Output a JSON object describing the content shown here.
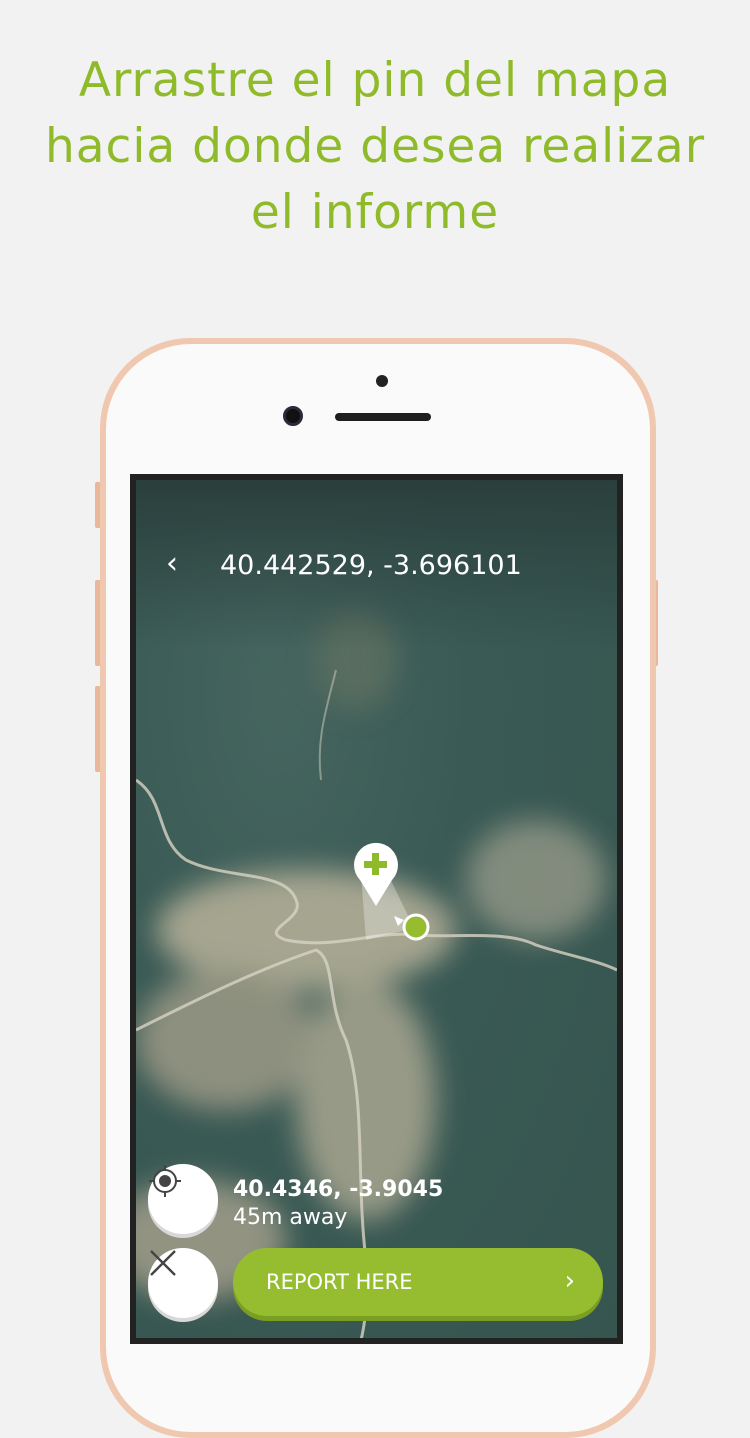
{
  "headline": {
    "line1": "Arrastre el pin del mapa",
    "line2": "hacia donde desea realizar",
    "line3": "el informe"
  },
  "map_screen": {
    "title_coords": "40.442529, -3.696101",
    "back_icon": "chevron-left",
    "current_location": {
      "coords": "40.4346, -3.9045",
      "distance": "45m away"
    },
    "report_button": "REPORT HERE",
    "colors": {
      "accent": "#95bd2f",
      "headline": "#8fbb2b"
    }
  }
}
